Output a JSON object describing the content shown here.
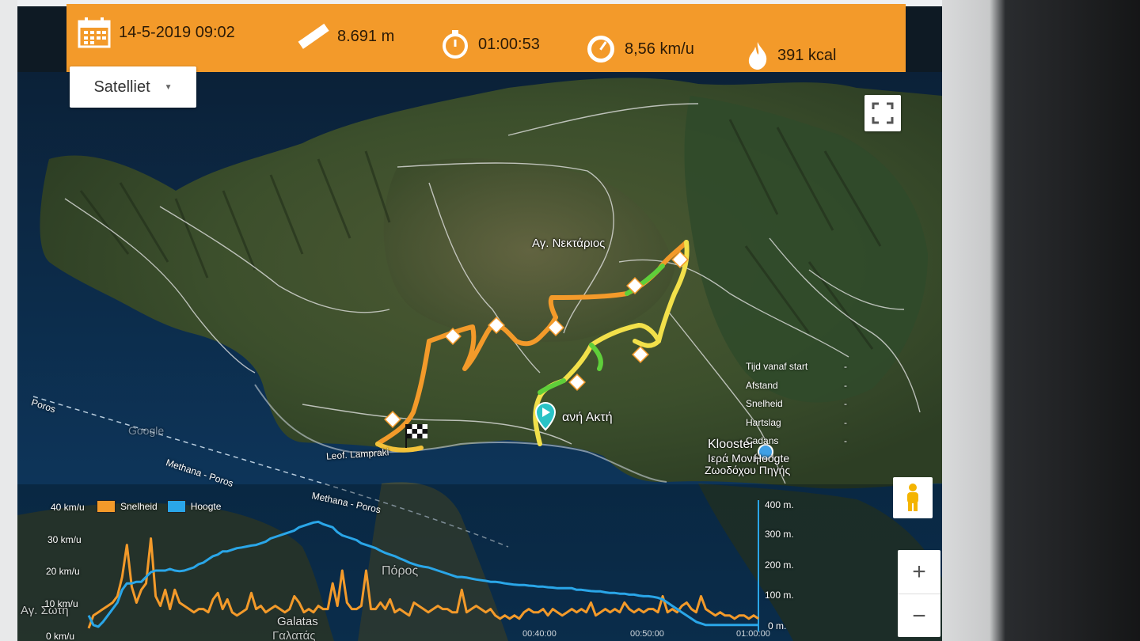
{
  "stats": {
    "date": "14-5-2019 09:02",
    "distance": "8.691 m",
    "duration": "01:00:53",
    "speed": "8,56 km/u",
    "calories": "391 kcal"
  },
  "map": {
    "type_label": "Satelliet",
    "places": {
      "nektarios": "Αγ. Νεκτάριος",
      "akti": "ανή Ακτή",
      "klooster": "Klooster",
      "klooster_gr1": "Ιερά Μονή",
      "klooster_gr2": "Ζωοδόχου Πηγής",
      "hoogte": "Hoogte",
      "leof": "Leof. Lampraki",
      "poros_left": "Poros",
      "methana_poros1": "Methana - Poros",
      "methana_poros2": "Methana - Poros",
      "google": "Google",
      "paros_city": "Πόρος",
      "galatas": "Galatas",
      "galatas_gr": "Γαλατάς",
      "ag_zoti": "Αγ. Σωτή"
    },
    "info": {
      "rows": [
        {
          "label": "Tijd vanaf start",
          "value": "-"
        },
        {
          "label": "Afstand",
          "value": "-"
        },
        {
          "label": "Snelheid",
          "value": "-"
        },
        {
          "label": "Hartslag",
          "value": "-"
        },
        {
          "label": "Cadans",
          "value": "-"
        }
      ]
    },
    "zoom_in": "+",
    "zoom_out": "−",
    "route_color": "#f39a2a",
    "altitude_color": "#2aa6e8"
  },
  "chart_data": {
    "type": "line",
    "legend": [
      {
        "name": "Snelheid",
        "color": "#f39a2a"
      },
      {
        "name": "Hoogte",
        "color": "#2aa6e8"
      }
    ],
    "y_left_ticks": [
      "40 km/u",
      "30 km/u",
      "20 km/u",
      "10 km/u",
      "0 km/u"
    ],
    "y_right_ticks": [
      "400 m.",
      "300 m.",
      "200 m.",
      "100 m.",
      "0 m."
    ],
    "x_ticks": [
      "00:40:00",
      "00:50:00",
      "01:00:00"
    ],
    "series": [
      {
        "name": "Snelheid",
        "y_axis": "left",
        "ylim": [
          0,
          40
        ],
        "values": [
          2,
          6,
          7,
          8,
          9,
          10,
          12,
          18,
          28,
          15,
          10,
          14,
          16,
          30,
          12,
          9,
          14,
          8,
          14,
          10,
          9,
          8,
          7,
          8,
          8,
          7,
          11,
          13,
          8,
          11,
          7,
          6,
          7,
          8,
          13,
          8,
          9,
          7,
          8,
          9,
          8,
          7,
          8,
          12,
          10,
          7,
          8,
          7,
          9,
          8,
          8,
          16,
          9,
          20,
          10,
          8,
          8,
          9,
          20,
          8,
          8,
          10,
          8,
          11,
          7,
          8,
          7,
          6,
          10,
          9,
          8,
          7,
          8,
          9,
          8,
          8,
          7,
          7,
          14,
          7,
          8,
          9,
          8,
          7,
          8,
          6,
          5,
          6,
          5,
          6,
          5,
          7,
          8,
          7,
          7,
          8,
          6,
          8,
          7,
          6,
          7,
          8,
          7,
          8,
          7,
          10,
          6,
          7,
          8,
          7,
          8,
          7,
          10,
          8,
          7,
          8,
          7,
          8,
          8,
          7,
          12,
          7,
          8,
          7,
          9,
          10,
          8,
          7,
          12,
          8,
          7,
          6,
          7,
          6,
          6,
          5,
          6,
          6,
          5,
          6,
          5
        ]
      },
      {
        "name": "Hoogte",
        "y_axis": "right",
        "ylim": [
          0,
          400
        ],
        "values": [
          60,
          30,
          25,
          40,
          60,
          80,
          100,
          140,
          160,
          160,
          165,
          165,
          180,
          195,
          200,
          200,
          200,
          205,
          200,
          198,
          200,
          205,
          210,
          220,
          225,
          235,
          245,
          250,
          260,
          260,
          265,
          270,
          272,
          275,
          278,
          280,
          285,
          290,
          300,
          305,
          310,
          315,
          320,
          325,
          335,
          340,
          345,
          350,
          352,
          345,
          340,
          335,
          320,
          310,
          305,
          300,
          295,
          285,
          280,
          275,
          270,
          262,
          255,
          250,
          245,
          238,
          232,
          225,
          220,
          215,
          212,
          210,
          205,
          200,
          195,
          190,
          185,
          180,
          180,
          178,
          175,
          172,
          170,
          168,
          165,
          165,
          163,
          160,
          158,
          156,
          155,
          155,
          153,
          152,
          150,
          150,
          148,
          147,
          145,
          145,
          145,
          145,
          140,
          140,
          138,
          136,
          135,
          135,
          132,
          130,
          130,
          128,
          128,
          125,
          125,
          122,
          120,
          120,
          118,
          115,
          110,
          100,
          90,
          80,
          70,
          60,
          50,
          40,
          35,
          30,
          30,
          30,
          30,
          30,
          30,
          30,
          30,
          30,
          30,
          30,
          30
        ]
      }
    ],
    "grid": false,
    "legend_placement": "top-left"
  }
}
